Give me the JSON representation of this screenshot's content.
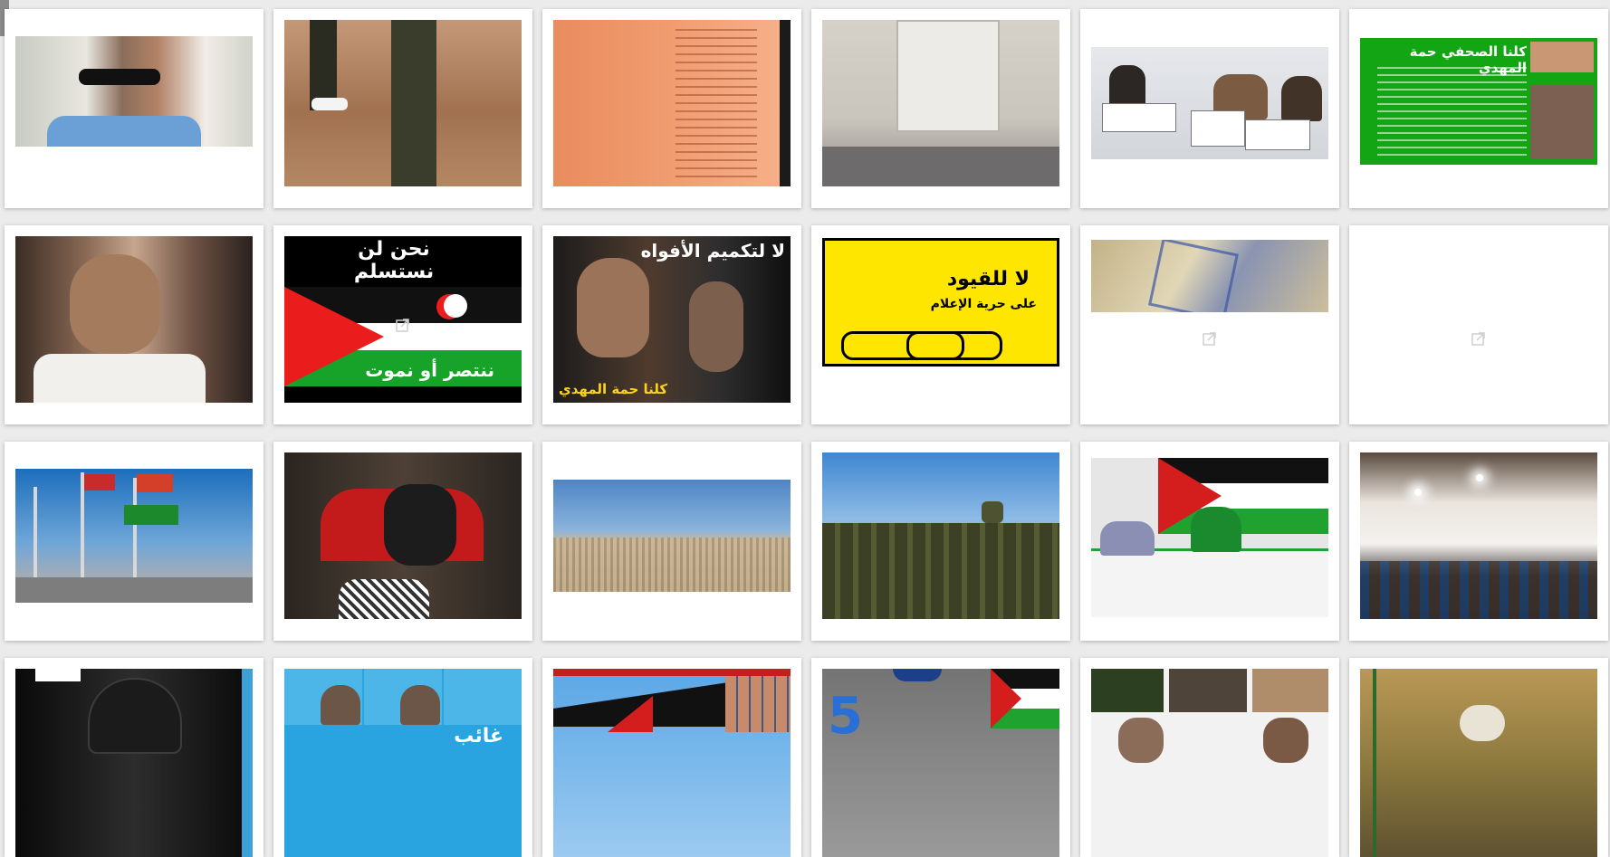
{
  "cards": [
    {
      "caption_ar": ""
    },
    {
      "caption_ar": ""
    },
    {
      "caption_ar": ""
    },
    {
      "caption_ar": ""
    },
    {
      "caption_ar": ""
    },
    {
      "caption_ar": "كلنا الصحفي حمة المهدي"
    },
    {
      "caption_ar": ""
    },
    {
      "caption_ar": "نحن لن نستسلم",
      "caption_ar_2": "ننتصر أو نموت"
    },
    {
      "caption_ar": "لا لتكميم الأفواه",
      "caption_ar_2": "كلنا حمة المهدي"
    },
    {
      "caption_ar": "لا للقيود",
      "caption_ar_2": "على حرية الإعلام"
    },
    {
      "caption_ar": ""
    },
    {
      "caption_ar": ""
    },
    {
      "caption_ar": ""
    },
    {
      "caption_ar": ""
    },
    {
      "caption_ar": ""
    },
    {
      "caption_ar": ""
    },
    {
      "caption_ar": ""
    },
    {
      "caption_ar": ""
    },
    {
      "caption_ar": ""
    },
    {
      "caption_ar": "غائب"
    },
    {
      "caption_ar": ""
    },
    {
      "caption_ar": "5"
    },
    {
      "caption_ar": ""
    },
    {
      "caption_ar": ""
    }
  ],
  "icons": {
    "external": "external-link-icon"
  },
  "colors": {
    "background": "#ebebeb",
    "card": "#ffffff",
    "yellow": "#ffe600",
    "green": "#1aa51a",
    "red": "#e11c1c"
  }
}
